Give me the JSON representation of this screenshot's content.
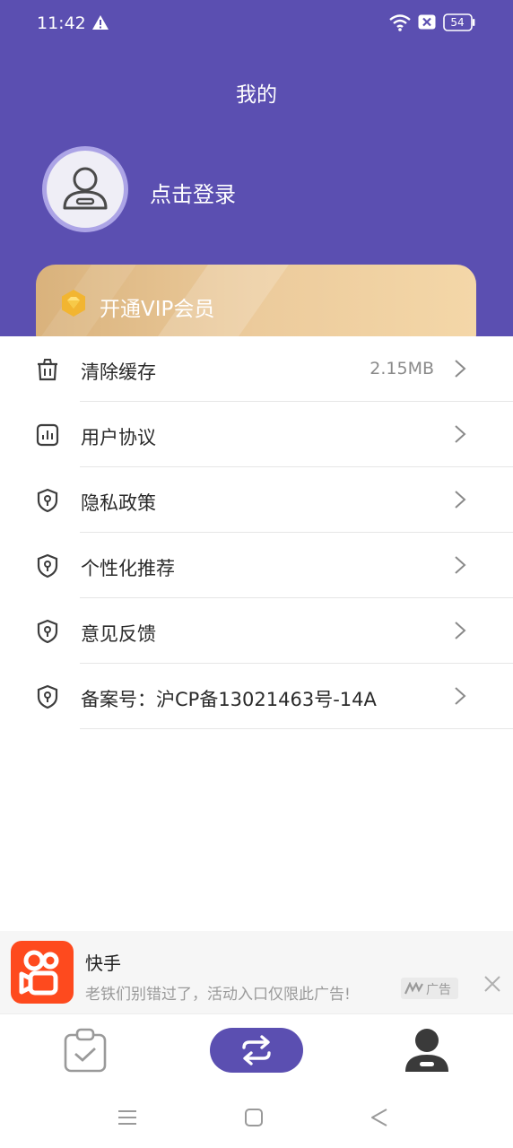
{
  "status_bar": {
    "time": "11:42",
    "battery": "54"
  },
  "header": {
    "title": "我的",
    "login_label": "点击登录"
  },
  "vip": {
    "label": "开通VIP会员"
  },
  "menu": {
    "items": [
      {
        "label": "清除缓存",
        "value": "2.15MB",
        "icon": "trash-icon"
      },
      {
        "label": "用户协议",
        "value": "",
        "icon": "chart-doc-icon"
      },
      {
        "label": "隐私政策",
        "value": "",
        "icon": "shield-icon"
      },
      {
        "label": "个性化推荐",
        "value": "",
        "icon": "shield-icon"
      },
      {
        "label": "意见反馈",
        "value": "",
        "icon": "shield-icon"
      },
      {
        "label": "备案号：沪CP备13021463号-14A",
        "value": "",
        "icon": "shield-icon"
      }
    ]
  },
  "ad": {
    "title": "快手",
    "description": "老铁们别错过了，活动入口仅限此广告!",
    "badge": "广告"
  },
  "colors": {
    "primary": "#5b4fb1",
    "vip_gold": "#e9c796",
    "ad_brand": "#fe4a1e"
  }
}
